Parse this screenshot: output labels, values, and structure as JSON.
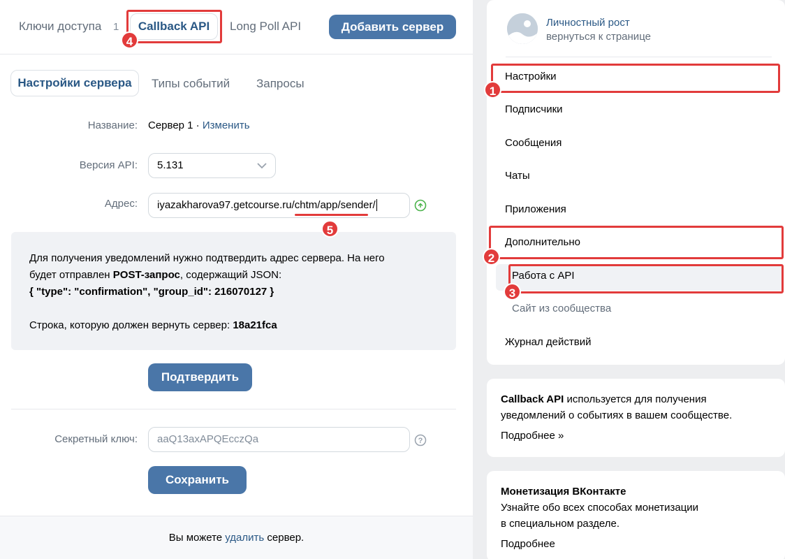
{
  "top_tabs": {
    "keys_label": "Ключи доступа",
    "keys_count": "1",
    "callback_label": "Callback API",
    "longpoll_label": "Long Poll API",
    "add_server_label": "Добавить сервер"
  },
  "sub_tabs": {
    "settings": "Настройки сервера",
    "events": "Типы событий",
    "requests": "Запросы"
  },
  "form": {
    "name_label": "Название:",
    "name_value": "Сервер 1 · ",
    "name_edit": "Изменить",
    "api_label": "Версия API:",
    "api_value": "5.131",
    "address_label": "Адрес:",
    "address_value": "iyazakharova97.getcourse.ru/chtm/app/sender/",
    "secret_label": "Секретный ключ:",
    "secret_placeholder": "aaQ13axAPQEcczQa",
    "confirm_button": "Подтвердить",
    "save_button": "Сохранить"
  },
  "notice": {
    "line1": "Для получения уведомлений нужно подтвердить адрес сервера. На него",
    "line2_prefix": "будет отправлен ",
    "line2_bold": "POST-запрос",
    "line2_suffix": ", содержащий JSON:",
    "line3": "{ \"type\": \"confirmation\", \"group_id\": 216070127 }",
    "line4_prefix": "Строка, которую должен вернуть сервер: ",
    "line4_code": "18a21fca"
  },
  "footer": {
    "prefix": "Вы можете ",
    "link": "удалить",
    "suffix": " сервер."
  },
  "sidebar": {
    "group_name": "Личностный рост",
    "group_back": "вернуться к странице",
    "items": [
      {
        "label": "Настройки"
      },
      {
        "label": "Подписчики"
      },
      {
        "label": "Сообщения"
      },
      {
        "label": "Чаты"
      },
      {
        "label": "Приложения"
      },
      {
        "label": "Дополнительно"
      },
      {
        "label": "Работа с API"
      },
      {
        "label": "Сайт из сообщества"
      },
      {
        "label": "Журнал действий"
      }
    ]
  },
  "info1": {
    "bold": "Callback API",
    "text1": " используется для получения",
    "text2": "уведомлений о событиях в вашем сообществе.",
    "more": "Подробнее »"
  },
  "info2": {
    "title": "Монетизация ВКонтакте",
    "text1": "Узнайте обо всех способах монетизации",
    "text2": "в специальном разделе.",
    "more": "Подробнее"
  },
  "annotations": [
    "1",
    "2",
    "3",
    "4",
    "5"
  ],
  "colors": {
    "accent": "#4a76a8",
    "link": "#2a5885",
    "annotation": "#e23b3b"
  }
}
